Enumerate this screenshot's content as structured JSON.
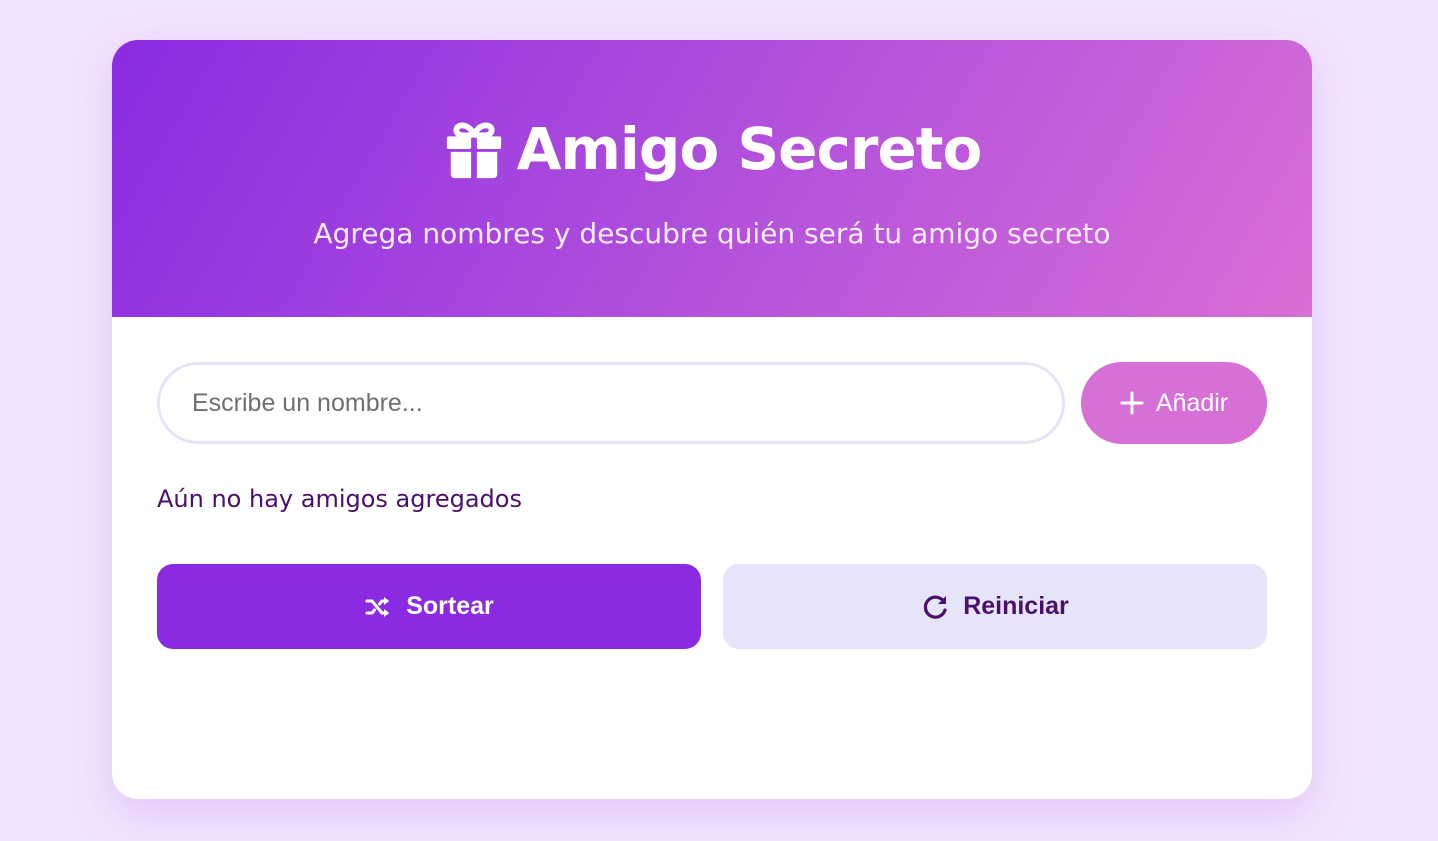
{
  "header": {
    "title": "Amigo Secreto",
    "subtitle": "Agrega nombres y descubre quién será tu amigo secreto",
    "icon": "gift-icon"
  },
  "form": {
    "input_placeholder": "Escribe un nombre...",
    "input_value": "",
    "add_label": "Añadir",
    "add_icon": "plus-icon"
  },
  "friends": {
    "items": [],
    "empty_message": "Aún no hay amigos agregados"
  },
  "actions": {
    "draw_label": "Sortear",
    "draw_icon": "shuffle-icon",
    "reset_label": "Reiniciar",
    "reset_icon": "redo-icon"
  },
  "colors": {
    "page_background": "#f3e4fd",
    "header_gradient_start": "#8a2be2",
    "header_gradient_end": "#d86ed6",
    "primary": "#8a2be2",
    "accent_pink": "#d670d6",
    "secondary_button": "#e6e4f9",
    "text_dark_purple": "#4b0f6e"
  }
}
